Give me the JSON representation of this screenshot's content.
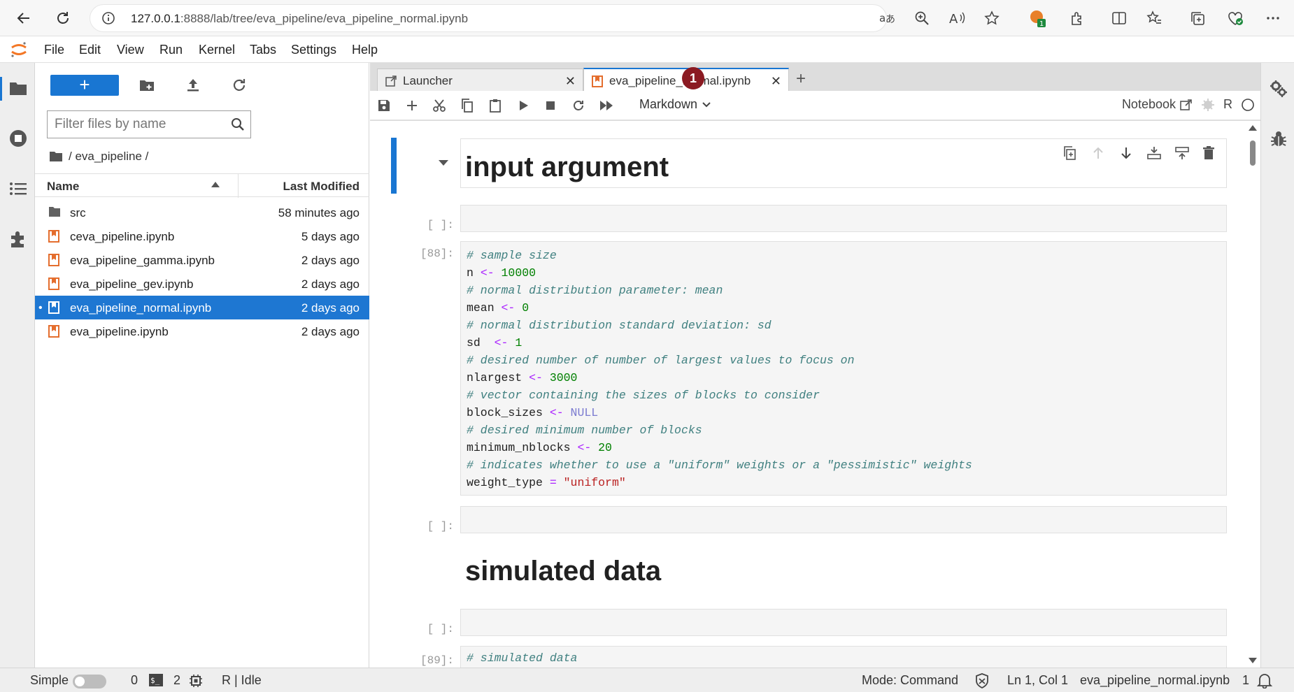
{
  "browser": {
    "url_host": "127.0.0.1",
    "url_rest": ":8888/lab/tree/eva_pipeline/eva_pipeline_normal.ipynb",
    "extension_badge": "1"
  },
  "menu": {
    "items": [
      "File",
      "Edit",
      "View",
      "Run",
      "Kernel",
      "Tabs",
      "Settings",
      "Help"
    ]
  },
  "filebrowser": {
    "new_label": "+",
    "filter_placeholder": "Filter files by name",
    "breadcrumb": "/ eva_pipeline /",
    "col_name": "Name",
    "col_modified": "Last Modified",
    "files": [
      {
        "name": "src",
        "modified": "58 minutes ago",
        "icon": "folder-icon"
      },
      {
        "name": "ceva_pipeline.ipynb",
        "modified": "5 days ago",
        "icon": "notebook-icon"
      },
      {
        "name": "eva_pipeline_gamma.ipynb",
        "modified": "2 days ago",
        "icon": "notebook-icon"
      },
      {
        "name": "eva_pipeline_gev.ipynb",
        "modified": "2 days ago",
        "icon": "notebook-icon"
      },
      {
        "name": "eva_pipeline_normal.ipynb",
        "modified": "2 days ago",
        "icon": "notebook-icon",
        "selected": true
      },
      {
        "name": "eva_pipeline.ipynb",
        "modified": "2 days ago",
        "icon": "notebook-icon"
      }
    ]
  },
  "tabs": {
    "launcher": "Launcher",
    "notebook": "eva_pipeline_normal.ipynb",
    "badge": "1"
  },
  "toolbar": {
    "cell_type": "Markdown",
    "notebook_label": "Notebook",
    "kernel_name": "R"
  },
  "notebook": {
    "heading1": "input argument",
    "empty_prompt": "[ ]:",
    "code_prompt": "[88]:",
    "heading2": "simulated data",
    "next_prompt": "[89]:",
    "next_code_comment": "# simulated data",
    "code_lines": [
      [
        [
          "c",
          "# sample size"
        ]
      ],
      [
        [
          "t",
          "n "
        ],
        [
          "op",
          "<-"
        ],
        [
          "t",
          " "
        ],
        [
          "num",
          "10000"
        ]
      ],
      [
        [
          "c",
          "# normal distribution parameter: mean"
        ]
      ],
      [
        [
          "t",
          "mean "
        ],
        [
          "op",
          "<-"
        ],
        [
          "t",
          " "
        ],
        [
          "num",
          "0"
        ]
      ],
      [
        [
          "c",
          "# normal distribution standard deviation: sd"
        ]
      ],
      [
        [
          "t",
          "sd  "
        ],
        [
          "op",
          "<-"
        ],
        [
          "t",
          " "
        ],
        [
          "num",
          "1"
        ]
      ],
      [
        [
          "c",
          "# desired number of number of largest values to focus on"
        ]
      ],
      [
        [
          "t",
          "nlargest "
        ],
        [
          "op",
          "<-"
        ],
        [
          "t",
          " "
        ],
        [
          "num",
          "3000"
        ]
      ],
      [
        [
          "c",
          "# vector containing the sizes of blocks to consider"
        ]
      ],
      [
        [
          "t",
          "block_sizes "
        ],
        [
          "op",
          "<-"
        ],
        [
          "t",
          " "
        ],
        [
          "kw",
          "NULL"
        ]
      ],
      [
        [
          "c",
          "# desired minimum number of blocks"
        ]
      ],
      [
        [
          "t",
          "minimum_nblocks "
        ],
        [
          "op",
          "<-"
        ],
        [
          "t",
          " "
        ],
        [
          "num",
          "20"
        ]
      ],
      [
        [
          "c",
          "# indicates whether to use a \"uniform\" weights or a \"pessimistic\" weights"
        ]
      ],
      [
        [
          "t",
          "weight_type "
        ],
        [
          "op",
          "="
        ],
        [
          "t",
          " "
        ],
        [
          "str",
          "\"uniform\""
        ]
      ]
    ]
  },
  "status": {
    "mode_label": "Simple",
    "terminals": "0",
    "kernels": "2",
    "kernel_status": "R | Idle",
    "mode": "Mode: Command",
    "cursor": "Ln 1, Col 1",
    "filename": "eva_pipeline_normal.ipynb",
    "notifications": "1"
  },
  "colors": {
    "accent": "#1976d2",
    "badge": "#8b1a22",
    "notebook_icon": "#e46e2e"
  }
}
